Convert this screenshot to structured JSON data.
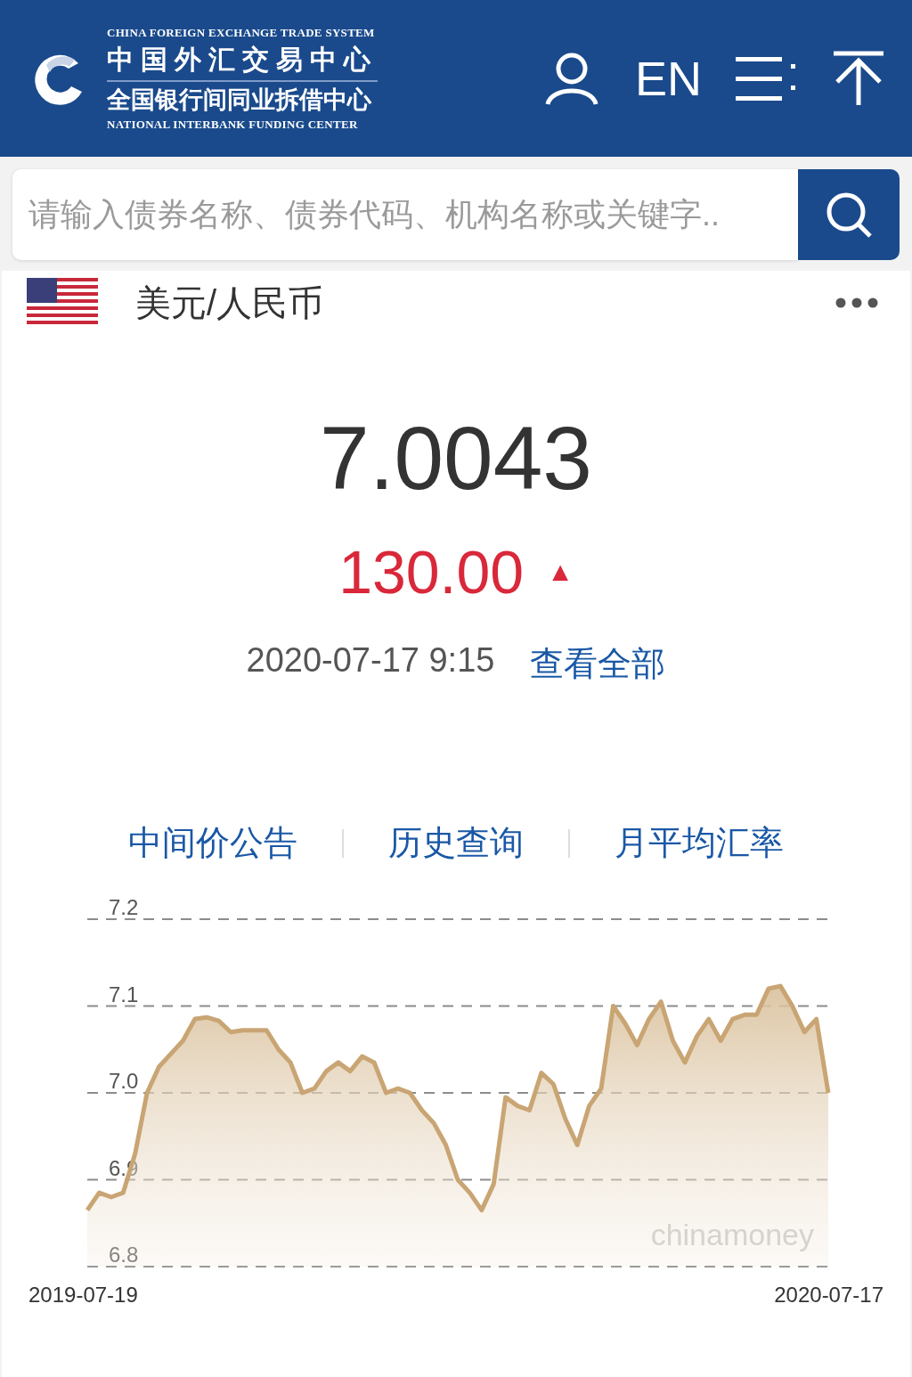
{
  "header": {
    "logo": {
      "line_en_top": "CHINA FOREIGN EXCHANGE TRADE SYSTEM",
      "line_cn_top": "中国外汇交易中心",
      "line_cn_bottom": "全国银行间同业拆借中心",
      "line_en_bottom": "NATIONAL INTERBANK FUNDING CENTER"
    },
    "language": "EN"
  },
  "search": {
    "placeholder": "请输入债券名称、债券代码、机构名称或关键字.."
  },
  "quote": {
    "pair": "美元/人民币",
    "price": "7.0043",
    "change": "130.00",
    "arrow": "▲",
    "time": "2020-07-17 9:15",
    "link": "查看全部"
  },
  "tabs": [
    {
      "label": "中间价公告"
    },
    {
      "label": "历史查询"
    },
    {
      "label": "月平均汇率"
    }
  ],
  "date_range": {
    "start": "2019-07-19",
    "end": "2020-07-17"
  },
  "chart_data": {
    "type": "line",
    "grid": true,
    "ylim": [
      6.8,
      7.2
    ],
    "yticks": [
      7.2,
      7.1,
      {
        "value": 7.0,
        "label": "7.0"
      },
      6.9,
      6.8
    ],
    "series": [
      {
        "color": "#c9a574",
        "values": [
          6.865,
          6.885,
          6.88,
          6.885,
          6.93,
          7.0,
          7.03,
          7.045,
          7.06,
          7.085,
          7.087,
          7.083,
          7.07,
          7.072,
          7.072,
          7.072,
          7.05,
          7.035,
          7.0,
          7.005,
          7.025,
          7.035,
          7.025,
          7.042,
          7.035,
          7.0,
          7.005,
          7.0,
          6.98,
          6.965,
          6.94,
          6.9,
          6.885,
          6.865,
          6.895,
          6.995,
          6.985,
          6.98,
          7.023,
          7.01,
          6.97,
          6.94,
          6.985,
          7.005,
          7.1,
          7.08,
          7.055,
          7.085,
          7.105,
          7.06,
          7.035,
          7.065,
          7.085,
          7.06,
          7.085,
          7.09,
          7.09,
          7.12,
          7.123,
          7.1,
          7.07,
          7.085,
          7.0
        ]
      }
    ],
    "annotations": [
      "chinamoney"
    ]
  }
}
